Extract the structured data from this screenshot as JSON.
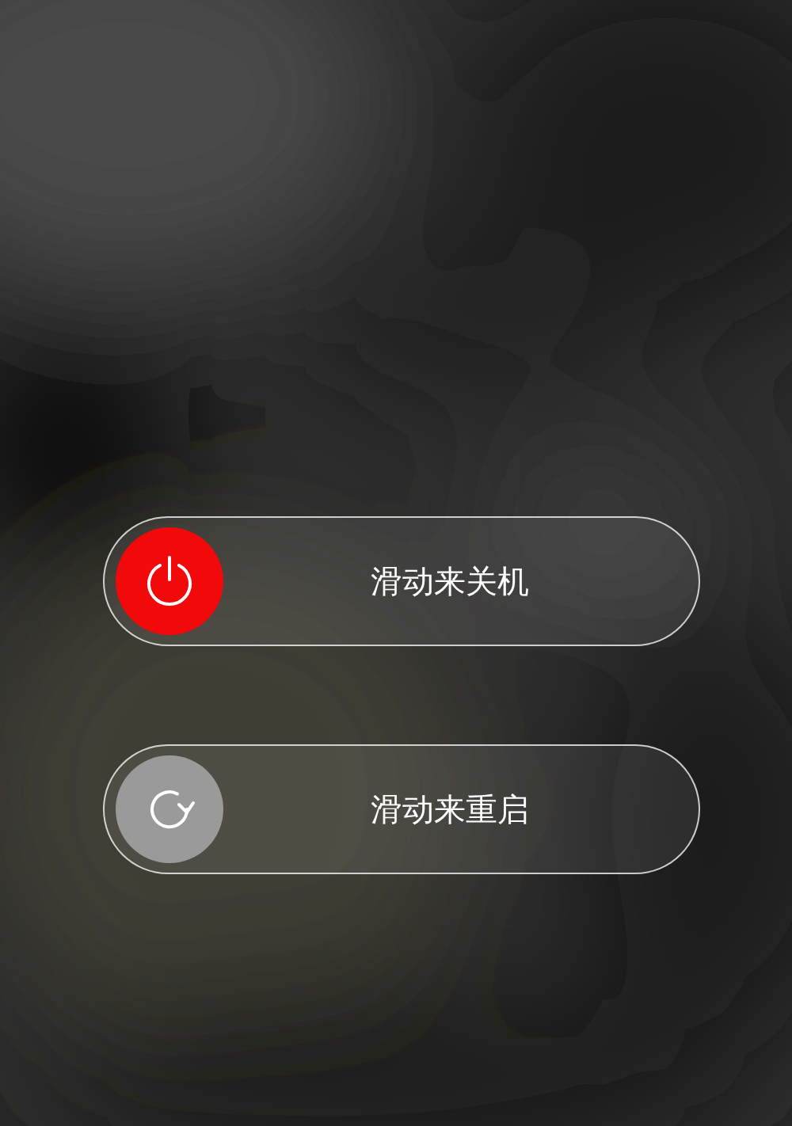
{
  "sliders": [
    {
      "kind": "power",
      "label": "滑动来关机"
    },
    {
      "kind": "restart",
      "label": "滑动来重启"
    }
  ]
}
